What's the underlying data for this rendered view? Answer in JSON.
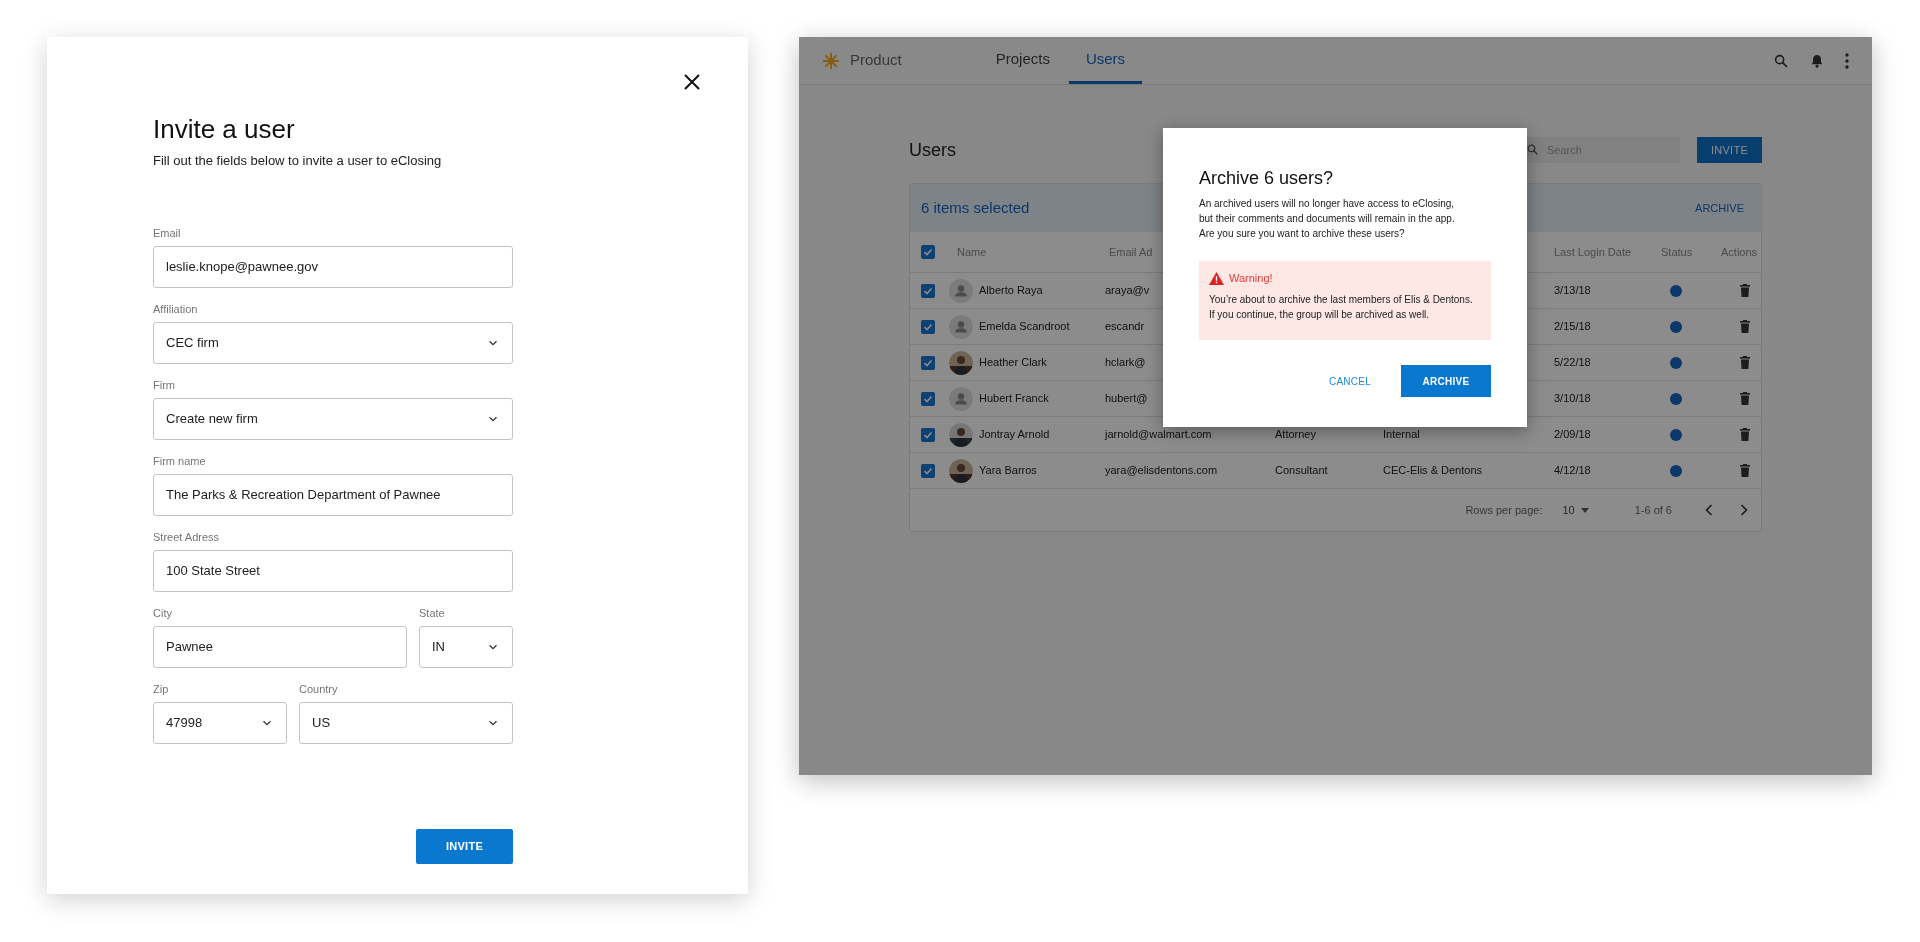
{
  "invite_panel": {
    "title": "Invite a user",
    "subtitle": "Fill out the fields below to invite a user to eClosing",
    "rows": [
      [
        {
          "label": "Email",
          "value": "leslie.knope@pawnee.gov",
          "kind": "text"
        }
      ],
      [
        {
          "label": "Affiliation",
          "value": "CEC firm",
          "kind": "select"
        }
      ],
      [
        {
          "label": "Firm",
          "value": "Create new firm",
          "kind": "select"
        }
      ],
      [
        {
          "label": "Firm name",
          "value": "The Parks & Recreation Department of Pawnee",
          "kind": "text"
        }
      ],
      [
        {
          "label": "Street Adress",
          "value": "100 State Street",
          "kind": "text"
        }
      ],
      [
        {
          "label": "City",
          "value": "Pawnee",
          "kind": "text"
        },
        {
          "label": "State",
          "value": "IN",
          "kind": "select"
        }
      ],
      [
        {
          "label": "Zip",
          "value": "47998",
          "kind": "select"
        },
        {
          "label": "Country",
          "value": "US",
          "kind": "select"
        }
      ]
    ],
    "submit": "INVITE"
  },
  "app": {
    "brand": "Product",
    "tabs": [
      {
        "label": "Projects",
        "selected": false
      },
      {
        "label": "Users",
        "selected": true
      }
    ],
    "page_title": "Users",
    "search": {
      "placeholder": "Search"
    },
    "invite_button": "INVITE",
    "selection_bar": {
      "count_text": "6 items selected",
      "action": "ARCHIVE"
    },
    "table": {
      "select_all_checked": true,
      "columns": {
        "name": "Name",
        "email": "Email Ad",
        "last_login": "Last Login Date",
        "status": "Status",
        "actions": "Actions"
      },
      "rows": [
        {
          "checked": true,
          "avatar": {
            "kind": "person"
          },
          "name": "Alberto Raya",
          "email": "araya@v",
          "last_login": "3/13/18"
        },
        {
          "checked": true,
          "avatar": {
            "kind": "person"
          },
          "name": "Emelda Scandroot",
          "email": "escandr",
          "last_login": "2/15/18"
        },
        {
          "checked": true,
          "name": "Heather Clark",
          "email": "hclark@",
          "last_login": "5/22/18"
        },
        {
          "checked": true,
          "avatar": {
            "kind": "person"
          },
          "name": "Hubert Franck",
          "email": "hubert@",
          "last_login": "3/10/18"
        },
        {
          "checked": true,
          "name": "Jontray Arnold",
          "email": "jarnold@walmart.com",
          "role": "Attorney",
          "affiliation": "Internal",
          "last_login": "2/09/18"
        },
        {
          "checked": true,
          "name": "Yara Barros",
          "email": "yara@elisdentons.com",
          "role": "Consultant",
          "affiliation": "CEC-Elis & Dentons",
          "last_login": "4/12/18"
        }
      ],
      "footer": {
        "rows_per_page_label": "Rows per page:",
        "rows_per_page": "10",
        "range": "1-6 of 6"
      }
    }
  },
  "dialog": {
    "title": "Archive 6 users?",
    "body_lines": [
      "An archived users will no longer have access to eClosing,",
      "but their comments and documents will remain in the app.",
      "Are you sure you want to archive these users?"
    ],
    "warning": {
      "title": "Warning!",
      "lines": [
        "You’re about to archive the last members of Elis & Dentons.",
        "If you continue, the group will be archived as well."
      ]
    },
    "buttons": [
      {
        "label": "CANCEL",
        "kind": "text"
      },
      {
        "label": "ARCHIVE",
        "kind": "primary"
      }
    ]
  }
}
